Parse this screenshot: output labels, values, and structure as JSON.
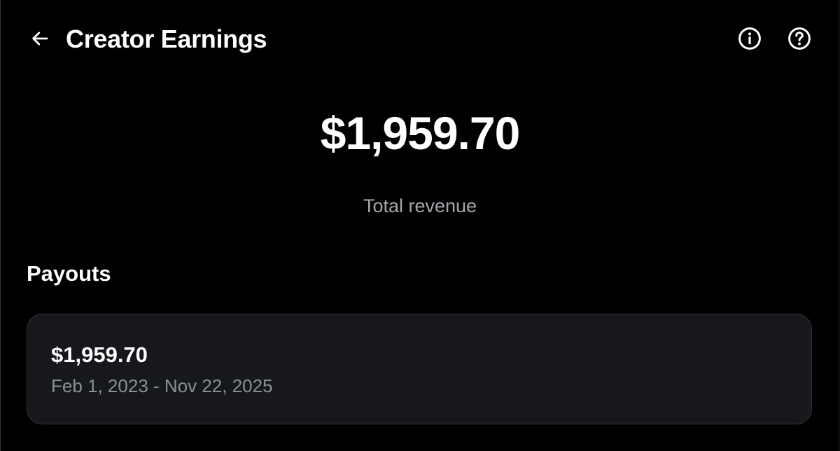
{
  "header": {
    "title": "Creator Earnings",
    "back_icon": "arrow-left-icon",
    "info_icon": "info-circle-icon",
    "help_icon": "question-circle-icon"
  },
  "summary": {
    "total_amount": "$1,959.70",
    "total_label": "Total revenue"
  },
  "payouts": {
    "section_title": "Payouts",
    "items": [
      {
        "amount": "$1,959.70",
        "date_range": "Feb 1, 2023 - Nov 22, 2025"
      }
    ]
  },
  "colors": {
    "background": "#000000",
    "card_background": "#16181c",
    "primary_text": "#ffffff",
    "secondary_text": "#8b9096"
  }
}
